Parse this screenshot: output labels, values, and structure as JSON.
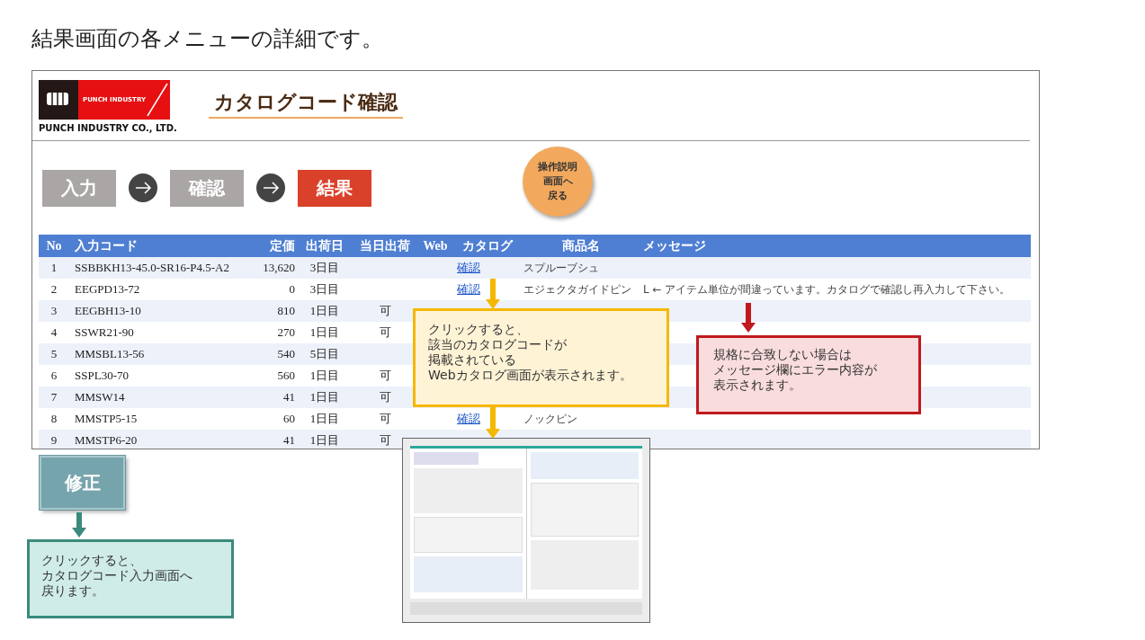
{
  "page_title": "結果画面の各メニューの詳細です。",
  "header": {
    "logo_brand": "PUNCH INDUSTRY",
    "logo_company": "PUNCH INDUSTRY CO., LTD.",
    "title": "カタログコード確認"
  },
  "steps": [
    {
      "label": "入力",
      "selected": false
    },
    {
      "label": "確認",
      "selected": false
    },
    {
      "label": "結果",
      "selected": true
    }
  ],
  "help_button": [
    "操作説明",
    "画面へ",
    "戻る"
  ],
  "table": {
    "columns": [
      "No",
      "入力コード",
      "定価",
      "出荷日",
      "当日出荷",
      "Web",
      "カタログ",
      "商品名",
      "メッセージ"
    ],
    "rows": [
      {
        "no": "1",
        "code": "SSBBKH13-45.0-SR16-P4.5-A2",
        "price": "13,620",
        "ship": "3日目",
        "catalog": "確認",
        "name": "スプルーブシュ"
      },
      {
        "no": "2",
        "code": "EEGPD13-72",
        "price": "0",
        "ship": "3日目",
        "catalog": "確認",
        "name": "エジェクタガイドピン",
        "message": "L ← アイテム単位が間違っています。カタログで確認し再入力して下さい。"
      },
      {
        "no": "3",
        "code": "EEGBH13-10",
        "price": "810",
        "ship": "1日目",
        "same_day": "可"
      },
      {
        "no": "4",
        "code": "SSWR21-90",
        "price": "270",
        "ship": "1日目",
        "same_day": "可"
      },
      {
        "no": "5",
        "code": "MMSBL13-56",
        "price": "540",
        "ship": "5日目"
      },
      {
        "no": "6",
        "code": "SSPL30-70",
        "price": "560",
        "ship": "1日目",
        "same_day": "可"
      },
      {
        "no": "7",
        "code": "MMSW14",
        "price": "41",
        "ship": "1日目",
        "same_day": "可"
      },
      {
        "no": "8",
        "code": "MMSTP5-15",
        "price": "60",
        "ship": "1日目",
        "same_day": "可",
        "catalog": "確認",
        "name": "ノックピン"
      },
      {
        "no": "9",
        "code": "MMSTP6-20",
        "price": "41",
        "ship": "1日目",
        "same_day": "可"
      }
    ]
  },
  "fix_button": "修正",
  "callouts": [
    {
      "kind": "yellow",
      "lines": [
        "クリックすると、",
        "該当のカタログコードが",
        "掲載されている",
        "Webカタログ画面が表示されます。"
      ]
    },
    {
      "kind": "red",
      "lines": [
        "規格に合致しない場合は",
        "メッセージ欄にエラー内容が",
        "表示されます。"
      ]
    },
    {
      "kind": "teal",
      "lines": [
        "クリックすると、",
        "カタログコード入力画面へ",
        "戻ります。"
      ]
    }
  ]
}
